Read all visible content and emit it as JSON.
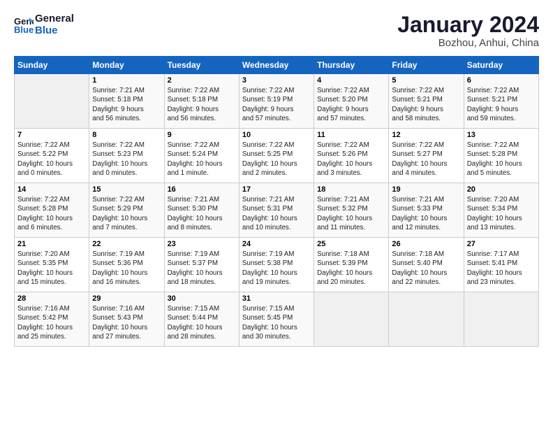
{
  "logo": {
    "line1": "General",
    "line2": "Blue"
  },
  "title": "January 2024",
  "subtitle": "Bozhou, Anhui, China",
  "weekdays": [
    "Sunday",
    "Monday",
    "Tuesday",
    "Wednesday",
    "Thursday",
    "Friday",
    "Saturday"
  ],
  "weeks": [
    [
      {
        "day": "",
        "info": ""
      },
      {
        "day": "1",
        "info": "Sunrise: 7:21 AM\nSunset: 5:18 PM\nDaylight: 9 hours\nand 56 minutes."
      },
      {
        "day": "2",
        "info": "Sunrise: 7:22 AM\nSunset: 5:18 PM\nDaylight: 9 hours\nand 56 minutes."
      },
      {
        "day": "3",
        "info": "Sunrise: 7:22 AM\nSunset: 5:19 PM\nDaylight: 9 hours\nand 57 minutes."
      },
      {
        "day": "4",
        "info": "Sunrise: 7:22 AM\nSunset: 5:20 PM\nDaylight: 9 hours\nand 57 minutes."
      },
      {
        "day": "5",
        "info": "Sunrise: 7:22 AM\nSunset: 5:21 PM\nDaylight: 9 hours\nand 58 minutes."
      },
      {
        "day": "6",
        "info": "Sunrise: 7:22 AM\nSunset: 5:21 PM\nDaylight: 9 hours\nand 59 minutes."
      }
    ],
    [
      {
        "day": "7",
        "info": "Sunrise: 7:22 AM\nSunset: 5:22 PM\nDaylight: 10 hours\nand 0 minutes."
      },
      {
        "day": "8",
        "info": "Sunrise: 7:22 AM\nSunset: 5:23 PM\nDaylight: 10 hours\nand 0 minutes."
      },
      {
        "day": "9",
        "info": "Sunrise: 7:22 AM\nSunset: 5:24 PM\nDaylight: 10 hours\nand 1 minute."
      },
      {
        "day": "10",
        "info": "Sunrise: 7:22 AM\nSunset: 5:25 PM\nDaylight: 10 hours\nand 2 minutes."
      },
      {
        "day": "11",
        "info": "Sunrise: 7:22 AM\nSunset: 5:26 PM\nDaylight: 10 hours\nand 3 minutes."
      },
      {
        "day": "12",
        "info": "Sunrise: 7:22 AM\nSunset: 5:27 PM\nDaylight: 10 hours\nand 4 minutes."
      },
      {
        "day": "13",
        "info": "Sunrise: 7:22 AM\nSunset: 5:28 PM\nDaylight: 10 hours\nand 5 minutes."
      }
    ],
    [
      {
        "day": "14",
        "info": "Sunrise: 7:22 AM\nSunset: 5:28 PM\nDaylight: 10 hours\nand 6 minutes."
      },
      {
        "day": "15",
        "info": "Sunrise: 7:22 AM\nSunset: 5:29 PM\nDaylight: 10 hours\nand 7 minutes."
      },
      {
        "day": "16",
        "info": "Sunrise: 7:21 AM\nSunset: 5:30 PM\nDaylight: 10 hours\nand 8 minutes."
      },
      {
        "day": "17",
        "info": "Sunrise: 7:21 AM\nSunset: 5:31 PM\nDaylight: 10 hours\nand 10 minutes."
      },
      {
        "day": "18",
        "info": "Sunrise: 7:21 AM\nSunset: 5:32 PM\nDaylight: 10 hours\nand 11 minutes."
      },
      {
        "day": "19",
        "info": "Sunrise: 7:21 AM\nSunset: 5:33 PM\nDaylight: 10 hours\nand 12 minutes."
      },
      {
        "day": "20",
        "info": "Sunrise: 7:20 AM\nSunset: 5:34 PM\nDaylight: 10 hours\nand 13 minutes."
      }
    ],
    [
      {
        "day": "21",
        "info": "Sunrise: 7:20 AM\nSunset: 5:35 PM\nDaylight: 10 hours\nand 15 minutes."
      },
      {
        "day": "22",
        "info": "Sunrise: 7:19 AM\nSunset: 5:36 PM\nDaylight: 10 hours\nand 16 minutes."
      },
      {
        "day": "23",
        "info": "Sunrise: 7:19 AM\nSunset: 5:37 PM\nDaylight: 10 hours\nand 18 minutes."
      },
      {
        "day": "24",
        "info": "Sunrise: 7:19 AM\nSunset: 5:38 PM\nDaylight: 10 hours\nand 19 minutes."
      },
      {
        "day": "25",
        "info": "Sunrise: 7:18 AM\nSunset: 5:39 PM\nDaylight: 10 hours\nand 20 minutes."
      },
      {
        "day": "26",
        "info": "Sunrise: 7:18 AM\nSunset: 5:40 PM\nDaylight: 10 hours\nand 22 minutes."
      },
      {
        "day": "27",
        "info": "Sunrise: 7:17 AM\nSunset: 5:41 PM\nDaylight: 10 hours\nand 23 minutes."
      }
    ],
    [
      {
        "day": "28",
        "info": "Sunrise: 7:16 AM\nSunset: 5:42 PM\nDaylight: 10 hours\nand 25 minutes."
      },
      {
        "day": "29",
        "info": "Sunrise: 7:16 AM\nSunset: 5:43 PM\nDaylight: 10 hours\nand 27 minutes."
      },
      {
        "day": "30",
        "info": "Sunrise: 7:15 AM\nSunset: 5:44 PM\nDaylight: 10 hours\nand 28 minutes."
      },
      {
        "day": "31",
        "info": "Sunrise: 7:15 AM\nSunset: 5:45 PM\nDaylight: 10 hours\nand 30 minutes."
      },
      {
        "day": "",
        "info": ""
      },
      {
        "day": "",
        "info": ""
      },
      {
        "day": "",
        "info": ""
      }
    ]
  ]
}
